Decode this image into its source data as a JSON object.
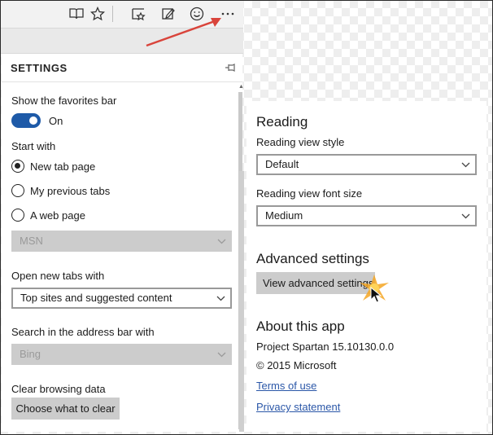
{
  "toolbar": {
    "icons": [
      "reading-view-icon",
      "favorite-star-icon",
      "hub-icon",
      "web-note-icon",
      "feedback-smiley-icon",
      "more-actions-icon"
    ]
  },
  "settings": {
    "title": "SETTINGS",
    "favorites_bar_label": "Show the favorites bar",
    "favorites_bar_state": "On",
    "start_with_label": "Start with",
    "start_options": [
      "New tab page",
      "My previous tabs",
      "A web page"
    ],
    "start_selected": 0,
    "web_page_value": "MSN",
    "new_tabs_label": "Open new tabs with",
    "new_tabs_value": "Top sites and suggested content",
    "search_label": "Search in the address bar with",
    "search_value": "Bing",
    "clear_label": "Clear browsing data",
    "clear_button": "Choose what to clear"
  },
  "right": {
    "reading_heading": "Reading",
    "reading_style_label": "Reading view style",
    "reading_style_value": "Default",
    "reading_font_label": "Reading view font size",
    "reading_font_value": "Medium",
    "advanced_heading": "Advanced settings",
    "advanced_button": "View advanced settings",
    "about_heading": "About this app",
    "version": "Project Spartan 15.10130.0.0",
    "copyright": "© 2015 Microsoft",
    "terms_link": "Terms of use",
    "privacy_link": "Privacy statement"
  },
  "colors": {
    "accent": "#1e5aa8",
    "annotation_arrow": "#d9443b",
    "link": "#2b57a8"
  }
}
